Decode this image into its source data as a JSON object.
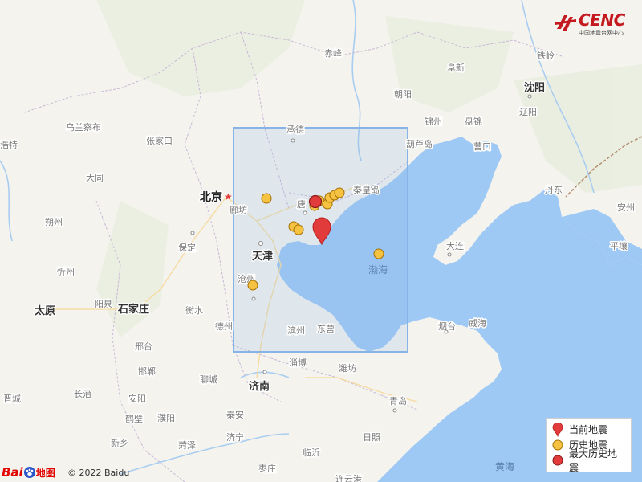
{
  "logo": {
    "name": "CENC",
    "subtitle": "中国地震台网中心"
  },
  "legend": {
    "current": "当前地震",
    "historical": "历史地震",
    "largest_historical": "最大历史地震"
  },
  "attribution": {
    "brand": "Bai",
    "brand_map": "地图",
    "copyright": "© 2022 Baidu"
  },
  "colors": {
    "current_quake": "#e23b3b",
    "historical_quake": "#f5c242",
    "largest_historical_quake": "#e23b3b",
    "sea": "#9ec9f5",
    "land": "#f4f3ee",
    "study_area": "#87b3e6"
  },
  "labels": {
    "beijing": "北京",
    "tianjin": "天津",
    "shijiazhuang": "石家庄",
    "taiyuan": "太原",
    "jinan": "济南",
    "shenyang": "沈阳",
    "bohai": "渤海",
    "huanghai": "黄海",
    "chengde": "承德",
    "qinhuangdao": "秦皇岛",
    "tangshan": "唐",
    "langfang": "廊坊",
    "baoding": "保定",
    "cangzhou": "沧州",
    "dezhou": "德州",
    "hengshui": "衡水",
    "xingtai": "邢台",
    "handan": "邯郸",
    "anyang": "安阳",
    "hebi": "鹤壁",
    "puyang": "濮阳",
    "xinxiang": "新乡",
    "heze": "菏泽",
    "jining": "济宁",
    "zaozhuang": "枣庄",
    "linyi": "临沂",
    "rizhao": "日照",
    "qingdao": "青岛",
    "weifang": "潍坊",
    "zibo": "淄博",
    "binzhou": "滨州",
    "dongying": "东营",
    "yantai": "烟台",
    "weihai": "威海",
    "dalian": "大连",
    "yingkou": "营口",
    "panjin": "盘锦",
    "jinzhou": "锦州",
    "huludao": "葫芦岛",
    "chaoyang": "朝阳",
    "fuxin": "阜新",
    "tieling": "铁岭",
    "liaoyang": "辽阳",
    "dandong": "丹东",
    "andong": "安州",
    "pingrang": "平壤",
    "chifeng": "赤峰",
    "zhangjiakou": "张家口",
    "datong": "大同",
    "shuozhou": "朔州",
    "xinzhou": "忻州",
    "yangquan": "阳泉",
    "changzhi": "长治",
    "jincheng": "晋城",
    "wulanchabu": "乌兰察布",
    "hohhot": "浩特",
    "liaocheng": "聊城",
    "taian": "泰安",
    "laiwu": "济宁",
    "xinyi": "连云港"
  }
}
